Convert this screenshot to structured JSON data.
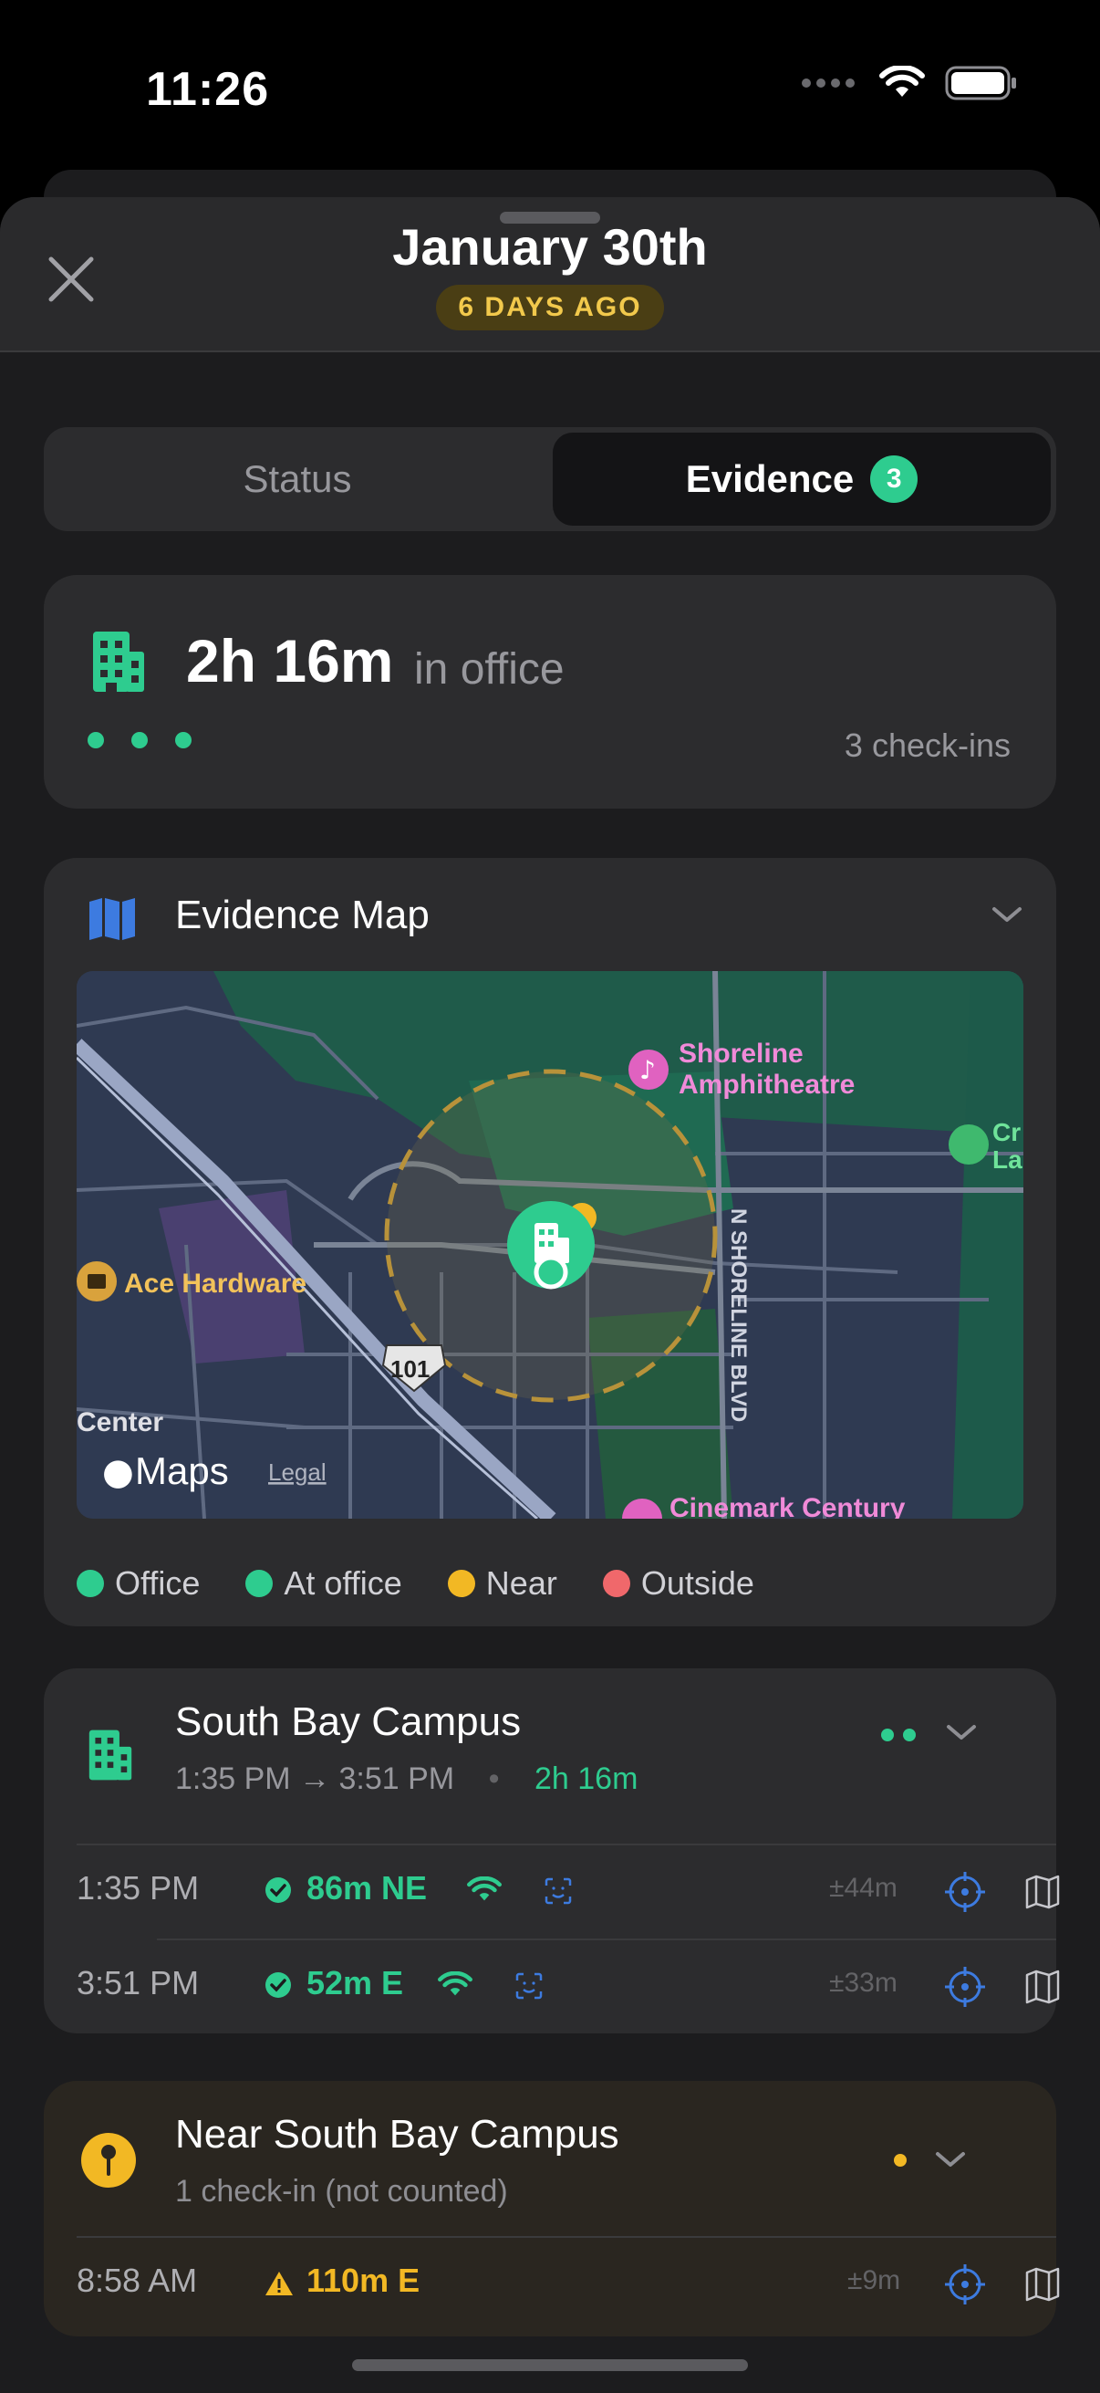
{
  "status_bar": {
    "time": "11:26"
  },
  "sheet": {
    "title": "January 30th",
    "badge": "6 DAYS AGO",
    "close_icon": "close-icon"
  },
  "tabs": [
    {
      "label": "Status",
      "selected": false
    },
    {
      "label": "Evidence",
      "selected": true,
      "count": "3"
    }
  ],
  "summary": {
    "duration": "2h 16m",
    "label": "in office",
    "checkins": "3 check-ins",
    "dot_count": 3
  },
  "evidence_map": {
    "title": "Evidence Map",
    "labels": {
      "shoreline": "Shoreline",
      "amphitheatre": "Amphitheatre",
      "ace": "Ace Hardware",
      "center": "Center",
      "road": "N SHORELINE BLVD",
      "highway": "101",
      "maps": "Maps",
      "legal": "Legal",
      "cinemark": "Cinemark Century",
      "cr": "Cr",
      "la": "La"
    },
    "legend": [
      {
        "label": "Office",
        "color": "#2ecc8f"
      },
      {
        "label": "At office",
        "color": "#2ecc8f"
      },
      {
        "label": "Near",
        "color": "#f2b824"
      },
      {
        "label": "Outside",
        "color": "#f0686b"
      }
    ]
  },
  "campus": {
    "name": "South Bay Campus",
    "time_range": "1:35 PM → 3:51 PM",
    "separator": "•",
    "duration": "2h 16m",
    "rows": [
      {
        "time": "1:35 PM",
        "distance": "86m NE",
        "accuracy": "±44m"
      },
      {
        "time": "3:51 PM",
        "distance": "52m E",
        "accuracy": "±33m"
      }
    ]
  },
  "near": {
    "name": "Near South Bay Campus",
    "subtitle": "1 check-in (not counted)",
    "rows": [
      {
        "time": "8:58 AM",
        "distance": "110m E",
        "accuracy": "±9m"
      }
    ]
  },
  "colors": {
    "accent_green": "#2ecc8f",
    "warning_yellow": "#f2b824",
    "blue_icon": "#3d7be0",
    "outside_red": "#f0686b"
  }
}
